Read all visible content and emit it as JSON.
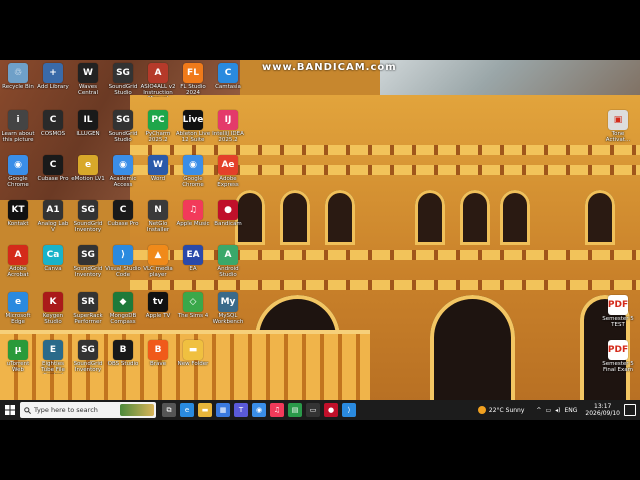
{
  "watermark": "www.BANDICAM.com",
  "desktop_icons": [
    {
      "label": "Recycle Bin",
      "color": "#6fa0c8",
      "glyph": "♲"
    },
    {
      "label": "Add Library",
      "color": "#3a6aa8",
      "glyph": "+"
    },
    {
      "label": "Waves Central",
      "color": "#222222",
      "glyph": "W"
    },
    {
      "label": "SoundGrid Studio",
      "color": "#333333",
      "glyph": "SG"
    },
    {
      "label": "ASIO4ALL v2 Instruction Manual",
      "color": "#b53a2a",
      "glyph": "A"
    },
    {
      "label": "FL Studio 2024",
      "color": "#f07a1a",
      "glyph": "FL"
    },
    {
      "label": "Camtasia",
      "color": "#2a8adf",
      "glyph": "C"
    },
    {
      "label": "Learn about this picture",
      "color": "#444444",
      "glyph": "i"
    },
    {
      "label": "COSMOS",
      "color": "#2a2a2a",
      "glyph": "C"
    },
    {
      "label": "ILLUGEN",
      "color": "#1a1a1a",
      "glyph": "IL"
    },
    {
      "label": "SoundGrid Studio",
      "color": "#333333",
      "glyph": "SG"
    },
    {
      "label": "PyCharm 2025.2",
      "color": "#1ea64a",
      "glyph": "PC"
    },
    {
      "label": "Ableton Live 12 Suite",
      "color": "#111111",
      "glyph": "Live"
    },
    {
      "label": "IntelliJ IDEA 2025.2",
      "color": "#e43a6a",
      "glyph": "IJ"
    },
    {
      "label": "Google Chrome",
      "color": "#3a8ee8",
      "glyph": "◉"
    },
    {
      "label": "Cubase Pro",
      "color": "#1a1a1a",
      "glyph": "C"
    },
    {
      "label": "eMotion LV1",
      "color": "#d8a82a",
      "glyph": "e"
    },
    {
      "label": "Academic Access",
      "color": "#3a8ee8",
      "glyph": "◉"
    },
    {
      "label": "Word",
      "color": "#2a5aaa",
      "glyph": "W"
    },
    {
      "label": "Google Chrome",
      "color": "#3a8ee8",
      "glyph": "◉"
    },
    {
      "label": "Adobe Express",
      "color": "#e4402a",
      "glyph": "Ae"
    },
    {
      "label": "Kontakt",
      "color": "#111111",
      "glyph": "KT"
    },
    {
      "label": "Analog Lab V",
      "color": "#333333",
      "glyph": "A1"
    },
    {
      "label": "SoundGrid Inventory",
      "color": "#333333",
      "glyph": "SG"
    },
    {
      "label": "Cubase Pro",
      "color": "#1a1a1a",
      "glyph": "C"
    },
    {
      "label": "NetGlo Installer",
      "color": "#3a3a3a",
      "glyph": "N"
    },
    {
      "label": "Apple Music",
      "color": "#f23a5a",
      "glyph": "♫"
    },
    {
      "label": "Bandicam",
      "color": "#c0102a",
      "glyph": "●"
    },
    {
      "label": "Adobe Acrobat",
      "color": "#d42a1a",
      "glyph": "A"
    },
    {
      "label": "Canva",
      "color": "#19b3c9",
      "glyph": "Ca"
    },
    {
      "label": "SoundGrid Inventory",
      "color": "#333333",
      "glyph": "SG"
    },
    {
      "label": "Visual Studio Code",
      "color": "#2a8adf",
      "glyph": "⟩"
    },
    {
      "label": "VLC media player",
      "color": "#f08a1a",
      "glyph": "▲"
    },
    {
      "label": "EA",
      "color": "#2a4aaa",
      "glyph": "EA"
    },
    {
      "label": "Android Studio",
      "color": "#3aa86a",
      "glyph": "A"
    },
    {
      "label": "Microsoft Edge",
      "color": "#2a8adf",
      "glyph": "e"
    },
    {
      "label": "Keygen Studio",
      "color": "#aa1a1a",
      "glyph": "K"
    },
    {
      "label": "SuperRack Performer",
      "color": "#333333",
      "glyph": "SR"
    },
    {
      "label": "MongoDB Compass",
      "color": "#1e7a3a",
      "glyph": "◆"
    },
    {
      "label": "Apple TV",
      "color": "#111111",
      "glyph": "tv"
    },
    {
      "label": "The Sims 4",
      "color": "#3aa84a",
      "glyph": "◇"
    },
    {
      "label": "MySQL Workbench",
      "color": "#3a6a8a",
      "glyph": "My"
    },
    {
      "label": "uTorrent Web",
      "color": "#2a9a3a",
      "glyph": "µ"
    },
    {
      "label": "Eighties Tube File Control",
      "color": "#2a6a8a",
      "glyph": "E"
    },
    {
      "label": "SoundGrid Inventory",
      "color": "#333333",
      "glyph": "SG"
    },
    {
      "label": "OBS Studio",
      "color": "#1a1a1a",
      "glyph": "B"
    },
    {
      "label": "Brave",
      "color": "#f05a1a",
      "glyph": "B"
    },
    {
      "label": "New Folder",
      "color": "#f0c040",
      "glyph": "▬"
    },
    {
      "label": "Tone Activat...",
      "color": "#dddddd",
      "glyph": "▣"
    },
    {
      "label": "Semester 5 TEST",
      "color": "#ffffff",
      "glyph": "PDF"
    },
    {
      "label": "Semester 5 Final Exam",
      "color": "#ffffff",
      "glyph": "PDF"
    }
  ],
  "taskbar": {
    "search_placeholder": "Type here to search",
    "pinned": [
      {
        "name": "task-view",
        "color": "#555555",
        "glyph": "⧉"
      },
      {
        "name": "edge",
        "color": "#2a8adf",
        "glyph": "e"
      },
      {
        "name": "file-explorer",
        "color": "#e8b53a",
        "glyph": "▬"
      },
      {
        "name": "store",
        "color": "#3a7ae0",
        "glyph": "▦"
      },
      {
        "name": "teams",
        "color": "#5a5ad8",
        "glyph": "T"
      },
      {
        "name": "chrome",
        "color": "#3a8ee8",
        "glyph": "◉"
      },
      {
        "name": "music",
        "color": "#f23a5a",
        "glyph": "♫"
      },
      {
        "name": "sheet",
        "color": "#2a9a4a",
        "glyph": "▤"
      },
      {
        "name": "terminal",
        "color": "#333333",
        "glyph": "▭"
      },
      {
        "name": "bandicam",
        "color": "#c0102a",
        "glyph": "●"
      },
      {
        "name": "vscode",
        "color": "#2a8adf",
        "glyph": "⟩"
      }
    ],
    "weather": "22°C  Sunny",
    "language": "ENG",
    "time": "13:17",
    "date": "2026/09/10"
  }
}
